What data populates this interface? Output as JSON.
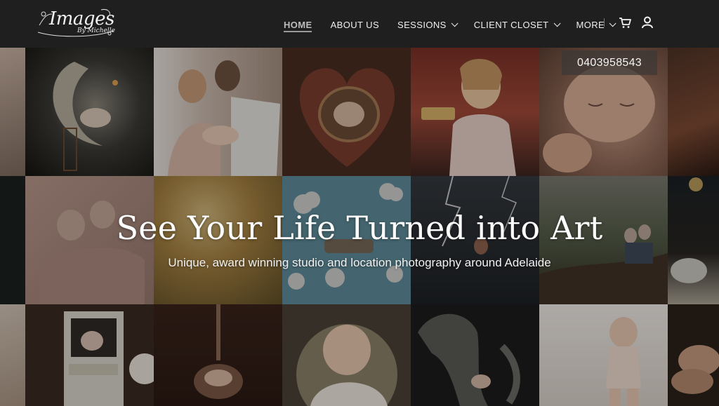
{
  "brand": {
    "logo_text": "Images",
    "logo_sub": "By Michelle"
  },
  "nav": {
    "items": [
      {
        "label": "HOME",
        "active": true
      },
      {
        "label": "ABOUT US"
      },
      {
        "label": "SESSIONS",
        "has_dropdown": true
      },
      {
        "label": "CLIENT CLOSET",
        "has_dropdown": true
      },
      {
        "label": "MORE",
        "has_dropdown": true
      }
    ],
    "cart_icon": "cart-icon",
    "account_icon": "user-icon"
  },
  "phone": "0403958543",
  "hero": {
    "title": "See Your Life Turned into Art",
    "subtitle": "Unique, award winning studio and location photography around Adelaide"
  },
  "colors": {
    "header_bg": "#1f1f1f",
    "text": "#efefef"
  }
}
